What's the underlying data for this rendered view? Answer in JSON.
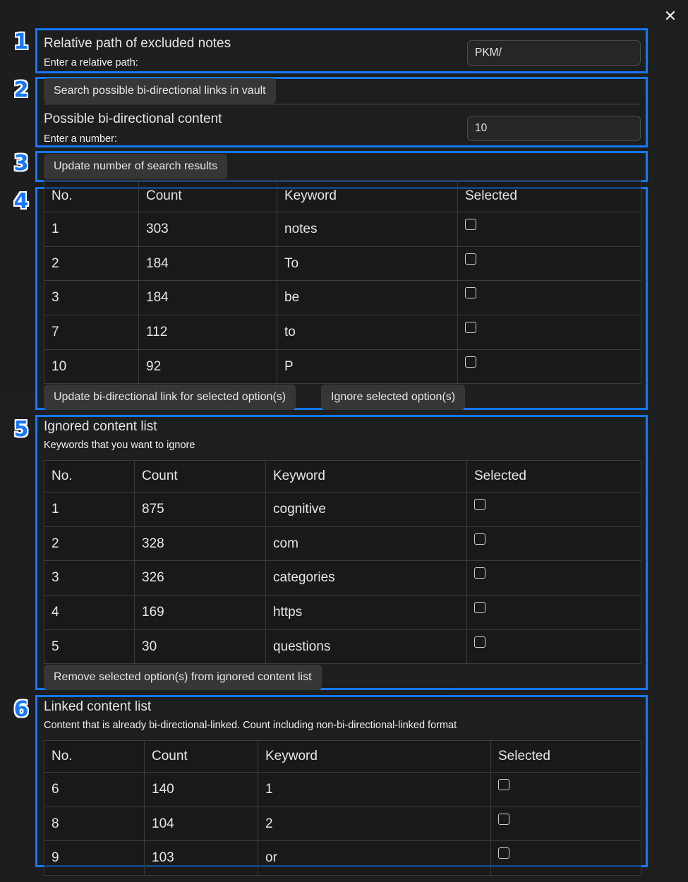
{
  "close_label": "✕",
  "excluded": {
    "name": "Relative path of excluded notes",
    "desc": "Enter a relative path:",
    "value": "PKM/"
  },
  "search": {
    "button_label": "Search possible bi-directional links in vault",
    "name": "Possible bi-directional content",
    "desc": "Enter a number:",
    "value": "10"
  },
  "update_search": {
    "button_label": "Update number of search results"
  },
  "possible_table": {
    "headers": [
      "No.",
      "Count",
      "Keyword",
      "Selected"
    ],
    "rows": [
      {
        "no": "1",
        "count": "303",
        "keyword": "notes"
      },
      {
        "no": "2",
        "count": "184",
        "keyword": "To"
      },
      {
        "no": "3",
        "count": "184",
        "keyword": "be"
      },
      {
        "no": "7",
        "count": "112",
        "keyword": "to"
      },
      {
        "no": "10",
        "count": "92",
        "keyword": "P"
      }
    ],
    "update_button": "Update bi-directional link for selected option(s)",
    "ignore_button": "Ignore selected option(s)"
  },
  "ignored": {
    "name": "Ignored content list",
    "desc": "Keywords that you want to ignore",
    "headers": [
      "No.",
      "Count",
      "Keyword",
      "Selected"
    ],
    "rows": [
      {
        "no": "1",
        "count": "875",
        "keyword": "cognitive"
      },
      {
        "no": "2",
        "count": "328",
        "keyword": "com"
      },
      {
        "no": "3",
        "count": "326",
        "keyword": "categories"
      },
      {
        "no": "4",
        "count": "169",
        "keyword": "https"
      },
      {
        "no": "5",
        "count": "30",
        "keyword": "questions"
      }
    ],
    "remove_button": "Remove selected option(s) from ignored content list"
  },
  "linked": {
    "name": "Linked content list",
    "desc": "Content that is already bi-directional-linked. Count including non-bi-directional-linked format",
    "headers": [
      "No.",
      "Count",
      "Keyword",
      "Selected"
    ],
    "rows": [
      {
        "no": "6",
        "count": "140",
        "keyword": "1"
      },
      {
        "no": "8",
        "count": "104",
        "keyword": "2"
      },
      {
        "no": "9",
        "count": "103",
        "keyword": "or"
      }
    ]
  },
  "annotations": [
    "1",
    "2",
    "3",
    "4",
    "5",
    "6"
  ],
  "colors": {
    "annotation": "#1677ff",
    "modal_bg": "#1e1e1e",
    "button_bg": "#363636"
  }
}
